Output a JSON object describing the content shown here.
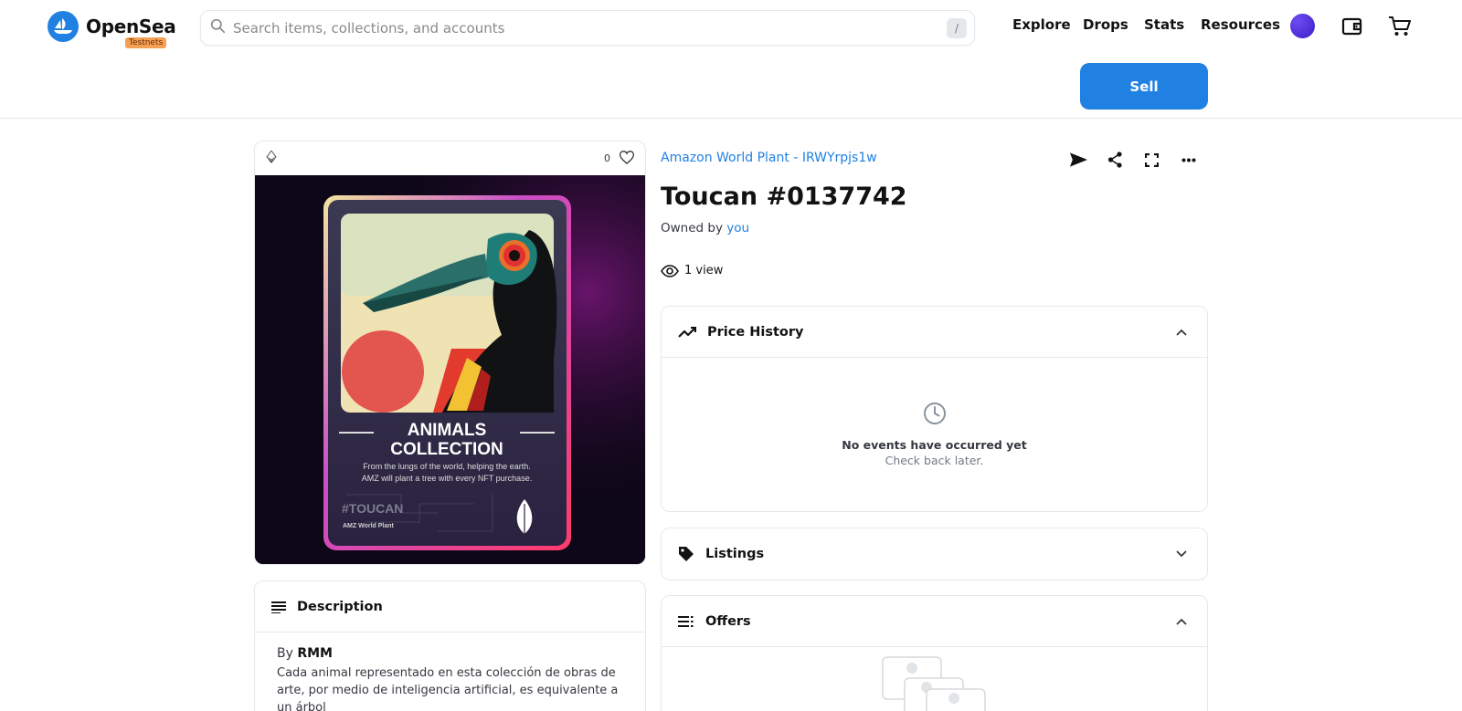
{
  "header": {
    "brand": "OpenSea",
    "badge": "Testnets",
    "search_placeholder": "Search items, collections, and accounts",
    "search_shortcut": "/",
    "nav": [
      "Explore",
      "Drops",
      "Stats",
      "Resources"
    ],
    "sell_label": "Sell"
  },
  "item": {
    "like_count": "0",
    "collection": "Amazon World Plant - IRWYrpjs1w",
    "title": "Toucan #0137742",
    "owned_by_label": "Owned by",
    "owner": "you",
    "views": "1 view"
  },
  "nft_card": {
    "heading_line1": "ANIMALS",
    "heading_line2": "COLLECTION",
    "tagline_line1": "From the lungs of the world, helping the earth.",
    "tagline_line2": "AMZ will plant a tree with every NFT purchase.",
    "hashtag": "#TOUCAN",
    "brand": "AMZ World Plant"
  },
  "description": {
    "heading": "Description",
    "by_label": "By",
    "author": "RMM",
    "text": "Cada animal representado en esta colección de obras de arte, por medio de inteligencia artificial, es equivalente a un árbol"
  },
  "price_history": {
    "heading": "Price History",
    "empty_title": "No events have occurred yet",
    "empty_sub": "Check back later."
  },
  "listings": {
    "heading": "Listings"
  },
  "offers": {
    "heading": "Offers"
  },
  "colors": {
    "accent": "#2081e2",
    "border": "#e5e8eb"
  }
}
